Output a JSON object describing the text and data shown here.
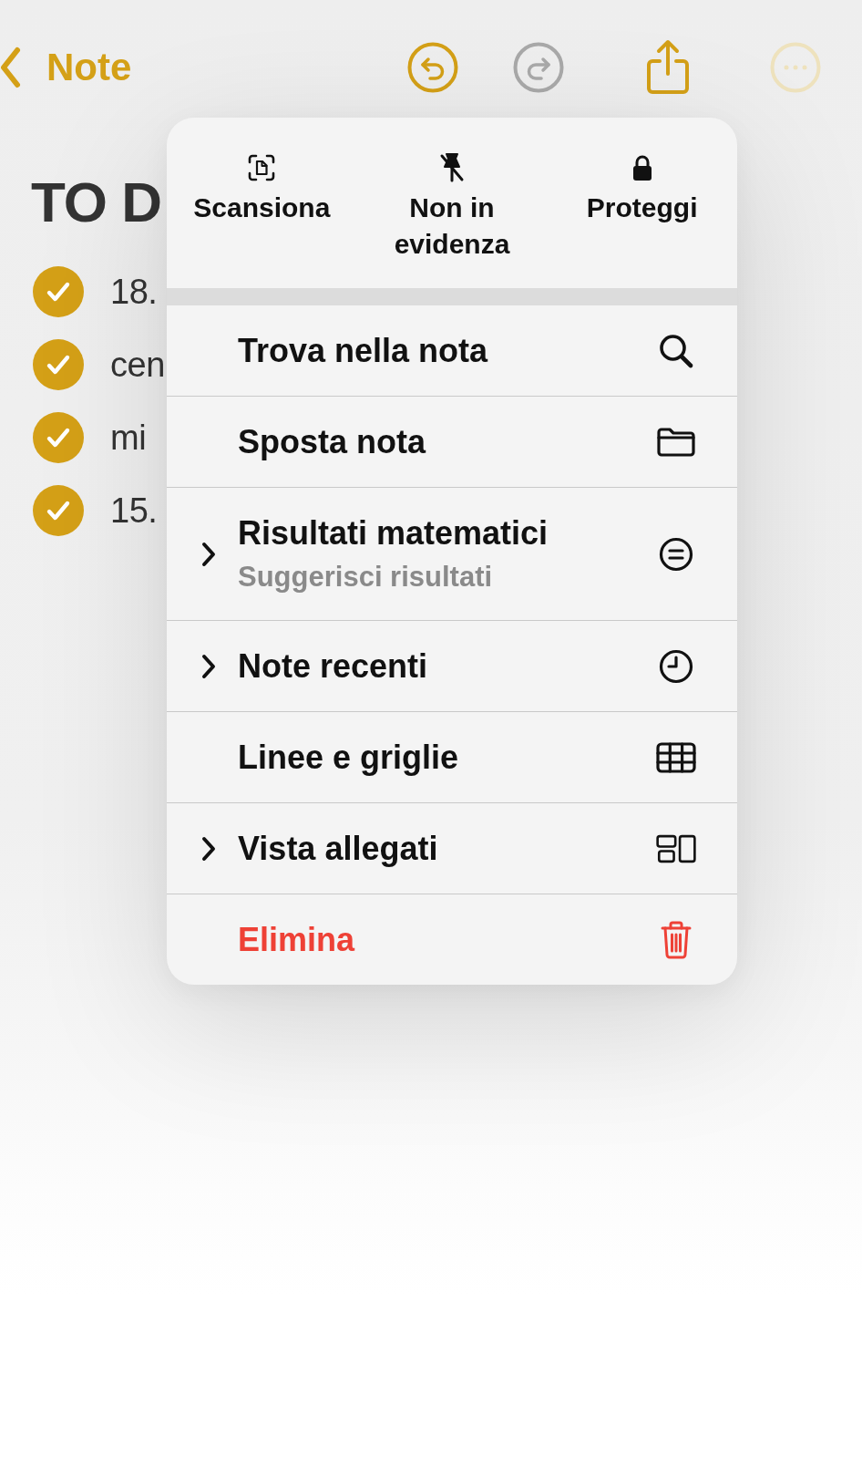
{
  "header": {
    "back": {
      "label": "Note"
    },
    "tools": [
      {
        "kind": "undo",
        "disabled": false,
        "expanded": false
      },
      {
        "kind": "redo",
        "disabled": true,
        "expanded": false
      },
      {
        "kind": "share",
        "disabled": false,
        "expanded": false
      },
      {
        "kind": "more",
        "disabled": false,
        "expanded": true
      }
    ]
  },
  "note": {
    "title": "TO D",
    "checklist": [
      {
        "text": "18.",
        "checked": true
      },
      {
        "text": "cen",
        "checked": true
      },
      {
        "text": "mi",
        "checked": true
      },
      {
        "text": "15.",
        "checked": true
      }
    ]
  },
  "menu": {
    "actions": [
      {
        "kind": "scan",
        "label": "Scansiona"
      },
      {
        "kind": "unpin",
        "label": "Non in evidenza"
      },
      {
        "kind": "lock",
        "label": "Proteggi"
      }
    ],
    "items": [
      {
        "label": "Trova nella nota",
        "kind": "search",
        "submenu": false,
        "destructive": false
      },
      {
        "label": "Sposta nota",
        "kind": "folder",
        "submenu": false,
        "destructive": false
      },
      {
        "label": "Risultati matematici",
        "subtitle": "Suggerisci risultati",
        "kind": "equals",
        "submenu": true,
        "destructive": false
      },
      {
        "label": "Note recenti",
        "kind": "clock",
        "submenu": true,
        "destructive": false
      },
      {
        "label": "Linee e griglie",
        "kind": "grid",
        "submenu": false,
        "destructive": false
      },
      {
        "label": "Vista allegati",
        "kind": "attachments",
        "submenu": true,
        "destructive": false
      },
      {
        "label": "Elimina",
        "kind": "trash",
        "submenu": false,
        "destructive": true
      }
    ]
  }
}
